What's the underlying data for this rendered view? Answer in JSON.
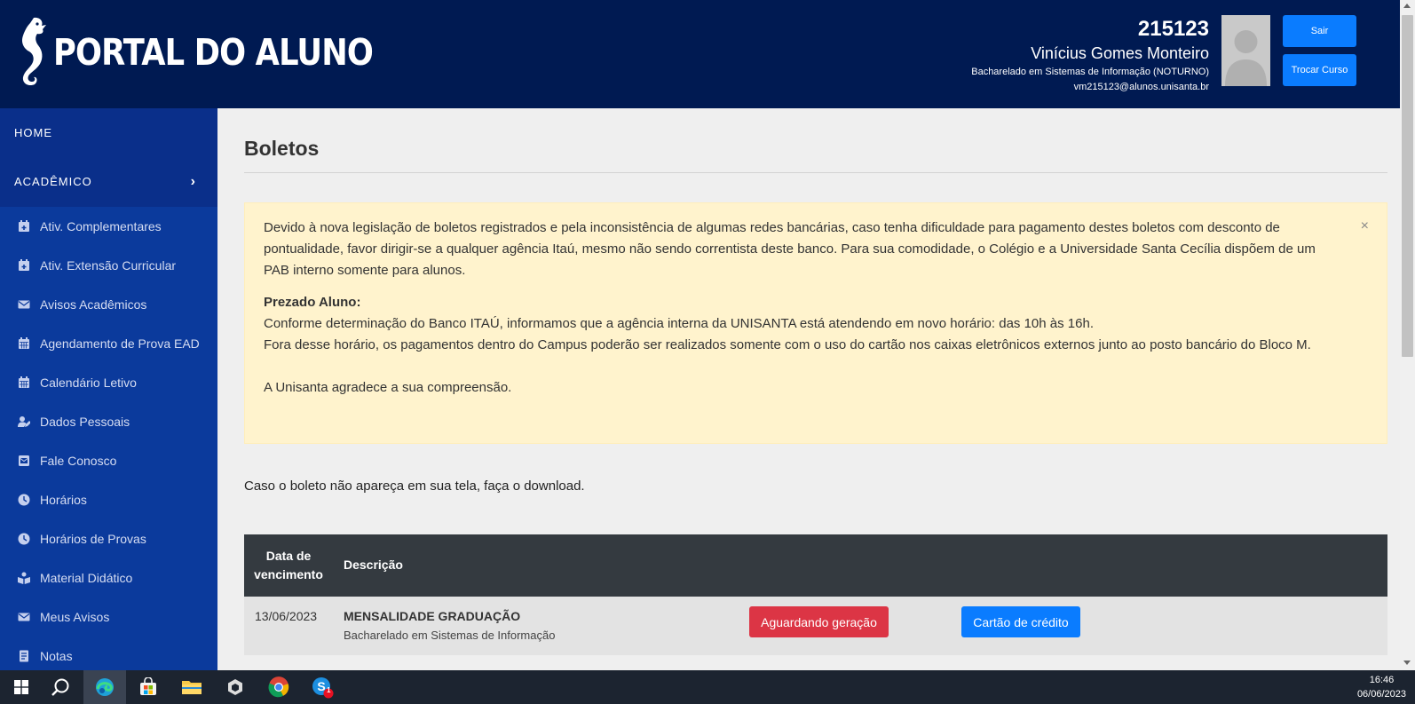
{
  "header": {
    "logo_text": "PORTAL DO ALUNO",
    "user_id": "215123",
    "user_name": "Vinícius Gomes Monteiro",
    "course": "Bacharelado em Sistemas de Informação (NOTURNO)",
    "email": "vm215123@alunos.unisanta.br",
    "logout_label": "Sair",
    "switch_course_label": "Trocar Curso"
  },
  "sidebar": {
    "home": "HOME",
    "academico": "ACADÊMICO",
    "items": [
      {
        "label": "Ativ. Complementares",
        "icon": "calendar-plus-icon"
      },
      {
        "label": "Ativ. Extensão Curricular",
        "icon": "calendar-plus-icon"
      },
      {
        "label": "Avisos Acadêmicos",
        "icon": "envelope-icon"
      },
      {
        "label": "Agendamento de Prova EAD",
        "icon": "calendar-icon"
      },
      {
        "label": "Calendário Letivo",
        "icon": "calendar-icon"
      },
      {
        "label": "Dados Pessoais",
        "icon": "user-edit-icon"
      },
      {
        "label": "Fale Conosco",
        "icon": "mail-bulk-icon"
      },
      {
        "label": "Horários",
        "icon": "clock-icon"
      },
      {
        "label": "Horários de Provas",
        "icon": "clock-icon"
      },
      {
        "label": "Material Didático",
        "icon": "book-reader-icon"
      },
      {
        "label": "Meus Avisos",
        "icon": "envelope-icon"
      },
      {
        "label": "Notas",
        "icon": "notes-icon"
      }
    ]
  },
  "main": {
    "title": "Boletos",
    "alert": {
      "p1": "Devido à nova legislação de boletos registrados e pela inconsistência de algumas redes bancárias, caso tenha dificuldade para pagamento destes boletos com desconto de pontualidade, favor dirigir-se a qualquer agência Itaú, mesmo não sendo correntista deste banco. Para sua comodidade, o Colégio e a Universidade Santa Cecília dispõem de um PAB interno somente para alunos.",
      "heading": "Prezado Aluno:",
      "p2": "Conforme determinação do Banco ITAÚ, informamos que a agência interna da UNISANTA está atendendo em novo horário: das 10h às 16h.",
      "p3": "Fora desse horário, os pagamentos dentro do Campus poderão ser realizados somente com o uso do cartão nos caixas eletrônicos externos junto ao posto bancário do Bloco M.",
      "p4": "A Unisanta agradece a sua compreensão.",
      "close": "×"
    },
    "download_note": "Caso o boleto não apareça em sua tela, faça o download.",
    "table": {
      "headers": [
        "Data de vencimento",
        "Descrição"
      ],
      "header_date_line1": "Data de",
      "header_date_line2": "vencimento",
      "rows": [
        {
          "date": "13/06/2023",
          "title": "MENSALIDADE GRADUAÇÃO",
          "subtitle": "Bacharelado em Sistemas de Informação",
          "status_label": "Aguardando geração",
          "card_label": "Cartão de crédito"
        }
      ]
    }
  },
  "taskbar": {
    "time": "16:46",
    "date": "06/06/2023",
    "badge": "1"
  },
  "colors": {
    "header_bg": "#001a52",
    "sidebar_bg": "#0b3a9c",
    "primary": "#0a7cff",
    "danger": "#dc3545",
    "alert_bg": "#fff3cd"
  }
}
